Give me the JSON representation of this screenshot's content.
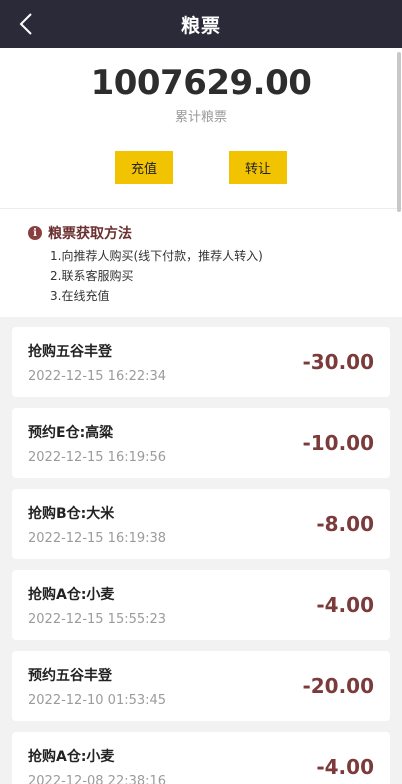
{
  "header": {
    "title": "粮票"
  },
  "summary": {
    "amount": "1007629.00",
    "label": "累计粮票",
    "buttons": {
      "recharge": "充值",
      "transfer": "转让"
    }
  },
  "howto": {
    "title": "粮票获取方法",
    "lines": [
      "1.向推荐人购买(线下付款，推荐人转入)",
      "2.联系客服购买",
      "3.在线充值"
    ]
  },
  "records": [
    {
      "name": "抢购五谷丰登",
      "time": "2022-12-15 16:22:34",
      "amount": "-30.00"
    },
    {
      "name": "预约E仓:高粱",
      "time": "2022-12-15 16:19:56",
      "amount": "-10.00"
    },
    {
      "name": "抢购B仓:大米",
      "time": "2022-12-15 16:19:38",
      "amount": "-8.00"
    },
    {
      "name": "抢购A仓:小麦",
      "time": "2022-12-15 15:55:23",
      "amount": "-4.00"
    },
    {
      "name": "预约五谷丰登",
      "time": "2022-12-10 01:53:45",
      "amount": "-20.00"
    },
    {
      "name": "抢购A仓:小麦",
      "time": "2022-12-08 22:38:16",
      "amount": "-4.00"
    }
  ],
  "colors": {
    "header_bg": "#2b2a38",
    "button_bg": "#f2c300",
    "amount_red": "#7c3b3b"
  }
}
